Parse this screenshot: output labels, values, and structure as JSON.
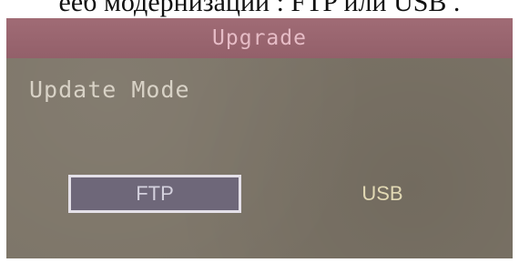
{
  "caption": "ееб модернизации : FTP или USB .",
  "window": {
    "title": "Upgrade"
  },
  "form": {
    "label": "Update Mode",
    "options": [
      {
        "label": "FTP",
        "selected": true
      },
      {
        "label": "USB",
        "selected": false
      }
    ]
  },
  "colors": {
    "title_bar": "#9a6570",
    "title_text": "#e6bcc6",
    "background": "#7c7467",
    "selected_option": "#6e6779",
    "unselected_option_text": "#e2d9b4"
  }
}
